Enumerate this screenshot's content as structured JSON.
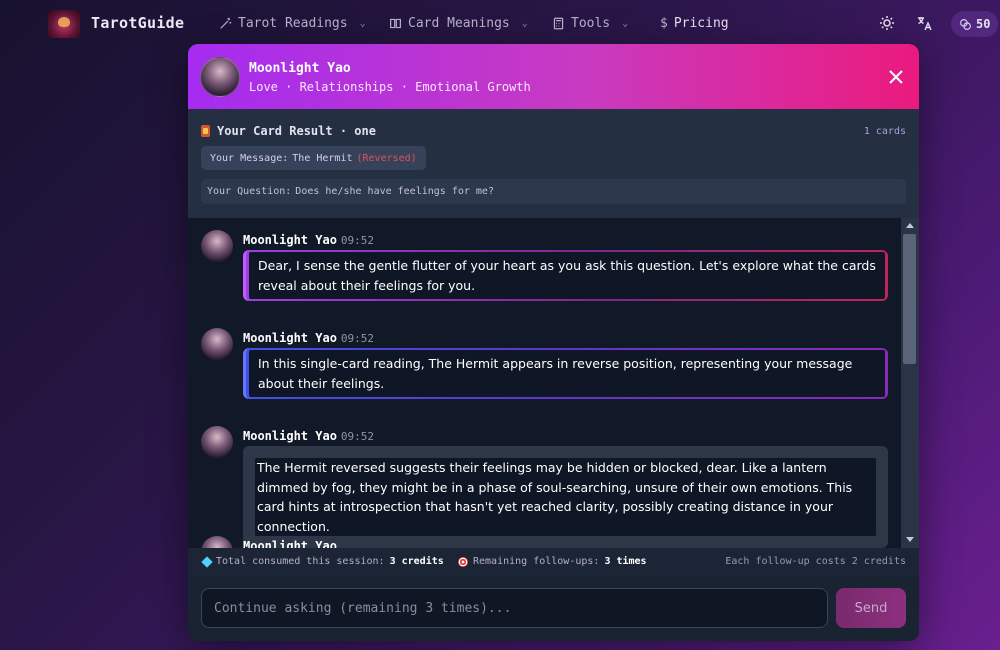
{
  "nav": {
    "brand": "TarotGuide",
    "items": [
      {
        "label": "Tarot Readings",
        "icon": "wand-icon",
        "has_dropdown": true
      },
      {
        "label": "Card Meanings",
        "icon": "book-icon",
        "has_dropdown": true
      },
      {
        "label": "Tools",
        "icon": "calculator-icon",
        "has_dropdown": true
      },
      {
        "label": "Pricing",
        "icon": "dollar-icon",
        "has_dropdown": false
      }
    ],
    "credits": "50"
  },
  "reader": {
    "name": "Moonlight Yao",
    "tags": "Love · Relationships · Emotional Growth"
  },
  "result": {
    "title": "Your Card Result · one",
    "count": "1 cards",
    "message_label": "Your Message:",
    "card_name": "The Hermit",
    "card_orientation": "(Reversed)",
    "question_label": "Your Question:",
    "question": "Does he/she have feelings for me?"
  },
  "messages": [
    {
      "name": "Moonlight Yao",
      "time": "09:52",
      "text": "Dear, I sense the gentle flutter of your heart as you ask this question. Let's explore what the cards reveal about their feelings for you."
    },
    {
      "name": "Moonlight Yao",
      "time": "09:52",
      "text": "In this single-card reading, The Hermit appears in reverse position, representing your message about their feelings."
    },
    {
      "name": "Moonlight Yao",
      "time": "09:52",
      "text": "The Hermit reversed suggests their feelings may be hidden or blocked, dear. Like a lantern dimmed by fog, they might be in a phase of soul-searching, unsure of their own emotions. This card hints at introspection that hasn't yet reached clarity, possibly creating distance in your connection."
    },
    {
      "name": "Moonlight Yao",
      "time": "",
      "text": ""
    }
  ],
  "stats": {
    "consumed_label": "Total consumed this session:",
    "consumed_value": "3 credits",
    "followups_label": "Remaining follow-ups:",
    "followups_value": "3 times",
    "cost_note": "Each follow-up costs 2 credits"
  },
  "composer": {
    "placeholder": "Continue asking (remaining 3 times)...",
    "send_label": "Send"
  },
  "colors": {
    "header_start": "#a52cf0",
    "header_end": "#ea1a7d",
    "reversed": "#e0505e"
  }
}
